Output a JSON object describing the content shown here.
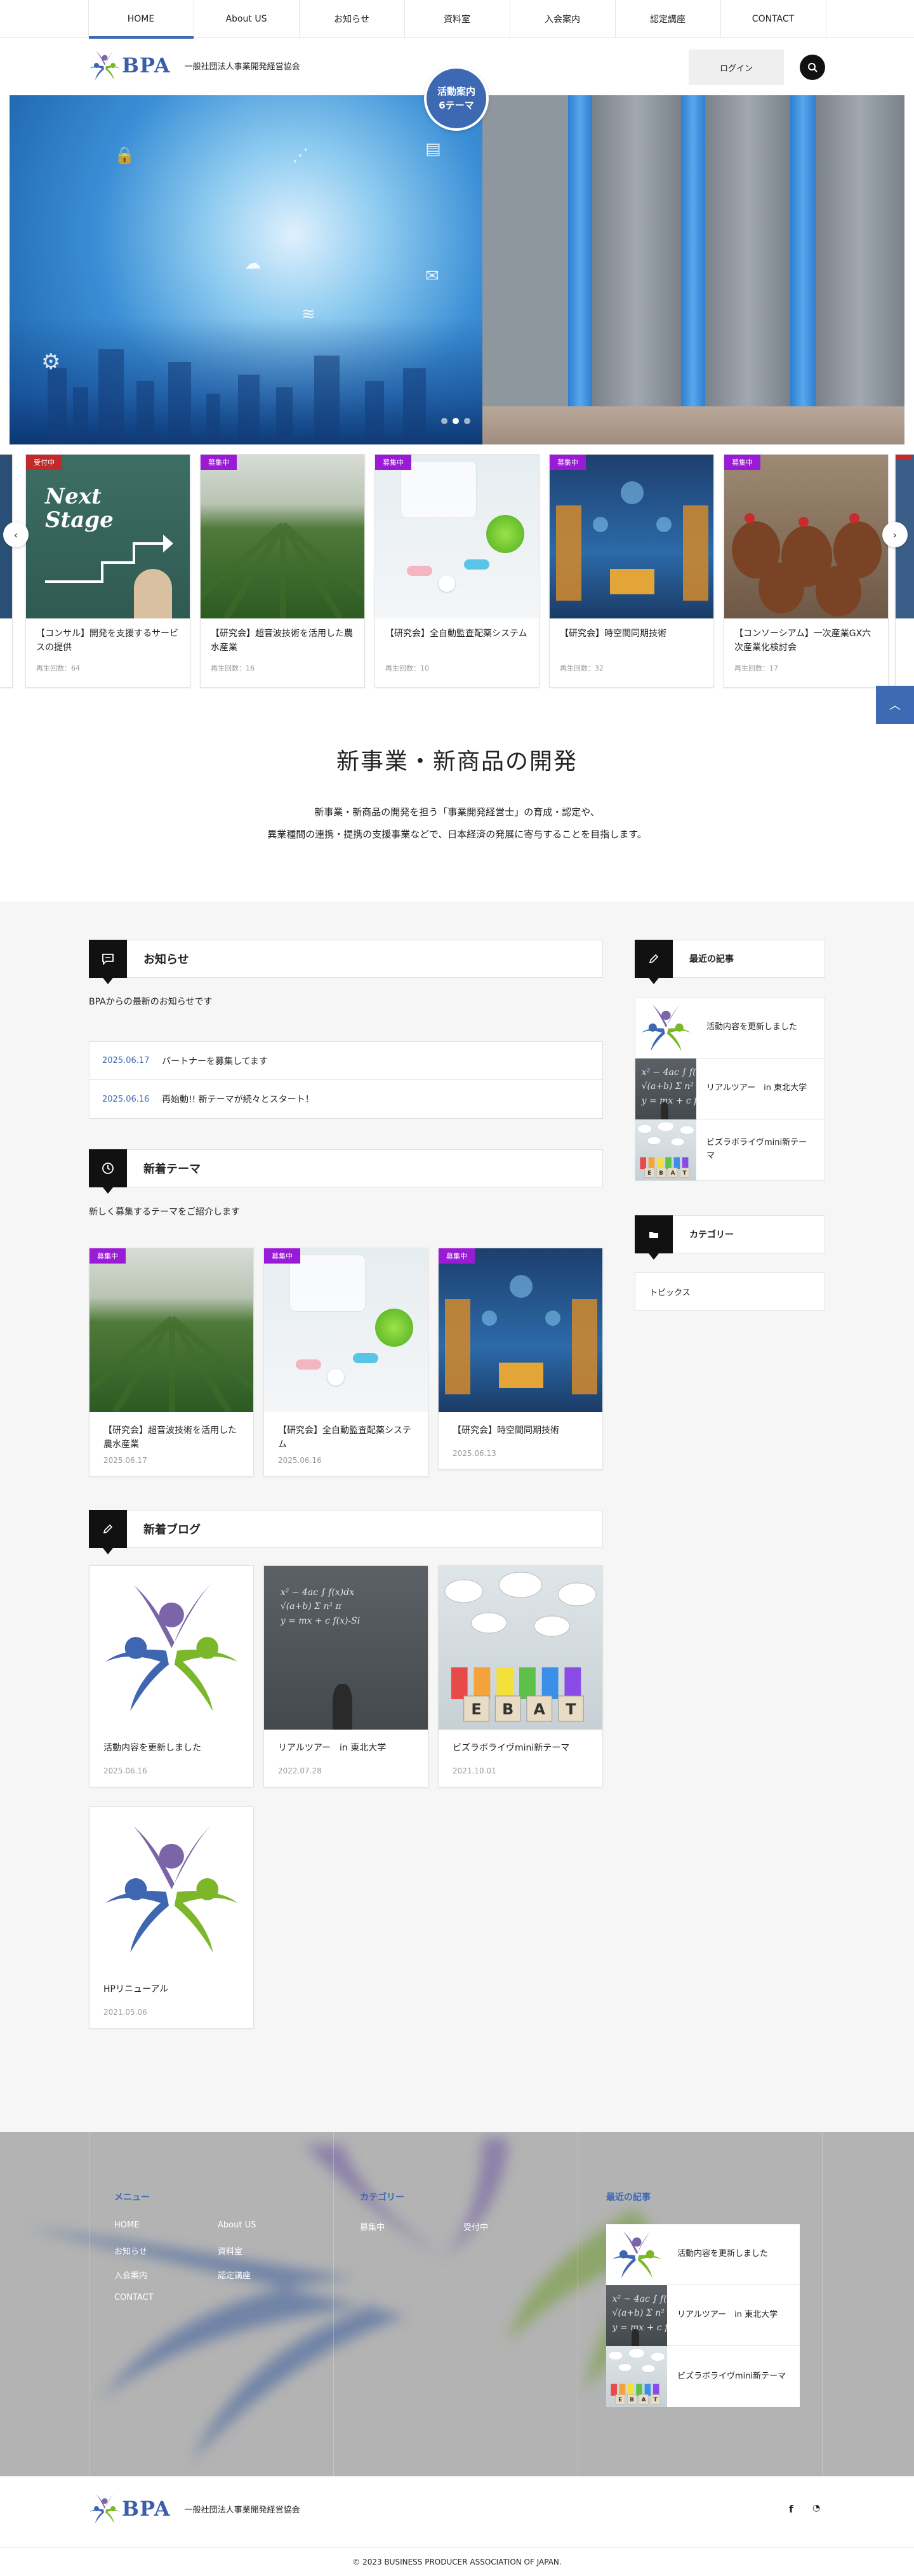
{
  "nav": {
    "items": [
      "HOME",
      "About US",
      "お知らせ",
      "資料室",
      "入会案内",
      "認定講座",
      "CONTACT"
    ]
  },
  "header": {
    "logo_text": "BPA",
    "org_name": "一般社団法人事業開発経営協会",
    "login_label": "ログイン",
    "badge_line1": "活動案内",
    "badge_line2": "6テーマ"
  },
  "carousel": {
    "cards": [
      {
        "tag": "受付中",
        "tag_type": "recv",
        "title": "【コンサル】開発を支援するサービスの提供",
        "meta": "再生回数：64",
        "img": "stage"
      },
      {
        "tag": "募集中",
        "tag_type": "recruit",
        "title": "【研究会】超音波技術を活用した農水産業",
        "meta": "再生回数：16",
        "img": "field"
      },
      {
        "tag": "募集中",
        "tag_type": "recruit",
        "title": "【研究会】全自動監査配薬システム",
        "meta": "再生回数：10",
        "img": "pills"
      },
      {
        "tag": "募集中",
        "tag_type": "recruit",
        "title": "【研究会】時空間同期技術",
        "meta": "再生回数：32",
        "img": "warehouse"
      },
      {
        "tag": "募集中",
        "tag_type": "recruit",
        "title": "【コンソーシアム】一次産業GX六次産業化検討会",
        "meta": "再生回数：17",
        "img": "chicken"
      }
    ]
  },
  "intro": {
    "title": "新事業・新商品の開発",
    "line1": "新事業・新商品の開発を担う「事業開発経営士」の育成・認定や、",
    "line2": "異業種間の連携・提携の支援事業などで、日本経済の発展に寄与することを目指します。"
  },
  "news": {
    "heading": "お知らせ",
    "desc": "BPAからの最新のお知らせです",
    "items": [
      {
        "date": "2025.06.17",
        "text": "パートナーを募集してます"
      },
      {
        "date": "2025.06.16",
        "text": "再始動!! 新テーマが続々とスタート！"
      }
    ]
  },
  "themes": {
    "heading": "新着テーマ",
    "desc": "新しく募集するテーマをご紹介します",
    "cards": [
      {
        "tag": "募集中",
        "title": "【研究会】超音波技術を活用した農水産業",
        "date": "2025.06.17",
        "img": "field"
      },
      {
        "tag": "募集中",
        "title": "【研究会】全自動監査配薬システム",
        "date": "2025.06.16",
        "img": "pills"
      },
      {
        "tag": "募集中",
        "title": "【研究会】時空間同期技術",
        "date": "2025.06.13",
        "img": "warehouse"
      }
    ]
  },
  "blog": {
    "heading": "新着ブログ",
    "cards": [
      {
        "title": "活動内容を更新しました",
        "date": "2025.06.16",
        "img": "logo"
      },
      {
        "title": "リアルツアー　in 東北大学",
        "date": "2022.07.28",
        "img": "board"
      },
      {
        "title": "ビズラボライヴmini新テーマ",
        "date": "2021.10.01",
        "img": "ebat"
      },
      {
        "title": "HPリニューアル",
        "date": "2021.05.06",
        "img": "logo"
      }
    ]
  },
  "sidebar": {
    "recent_heading": "最近の記事",
    "recent": [
      {
        "title": "活動内容を更新しました",
        "img": "logo"
      },
      {
        "title": "リアルツアー　in 東北大学",
        "img": "board"
      },
      {
        "title": "ビズラボライヴmini新テーマ",
        "img": "ebat"
      }
    ],
    "category_heading": "カテゴリー",
    "categories": [
      "トピックス"
    ]
  },
  "footer": {
    "menu_heading": "メニュー",
    "menu_col1": [
      "HOME",
      "お知らせ",
      "入会案内",
      "CONTACT"
    ],
    "menu_col2": [
      "About US",
      "資料室",
      "認定講座"
    ],
    "category_heading": "カテゴリー",
    "categories": [
      "募集中",
      "受付中"
    ],
    "recent_heading": "最近の記事",
    "recent": [
      {
        "title": "活動内容を更新しました",
        "img": "logo"
      },
      {
        "title": "リアルツアー　in 東北大学",
        "img": "board"
      },
      {
        "title": "ビズラボライヴmini新テーマ",
        "img": "ebat"
      }
    ],
    "org_name": "一般社団法人事業開発経営協会",
    "copyright": "© 2023 BUSINESS PRODUCER ASSOCIATION OF JAPAN."
  },
  "colors": {
    "brand_blue": "#3e6ab3",
    "recruit_purple": "#9a1bd6",
    "receiving_red": "#c02a2a"
  },
  "icons": {
    "search": "search-icon",
    "news": "chat-icon",
    "themes": "clock-icon",
    "blog": "pencil-icon",
    "category": "folder-icon",
    "facebook": "facebook-icon",
    "rss": "rss-icon",
    "page_top": "chevron-up-icon"
  }
}
